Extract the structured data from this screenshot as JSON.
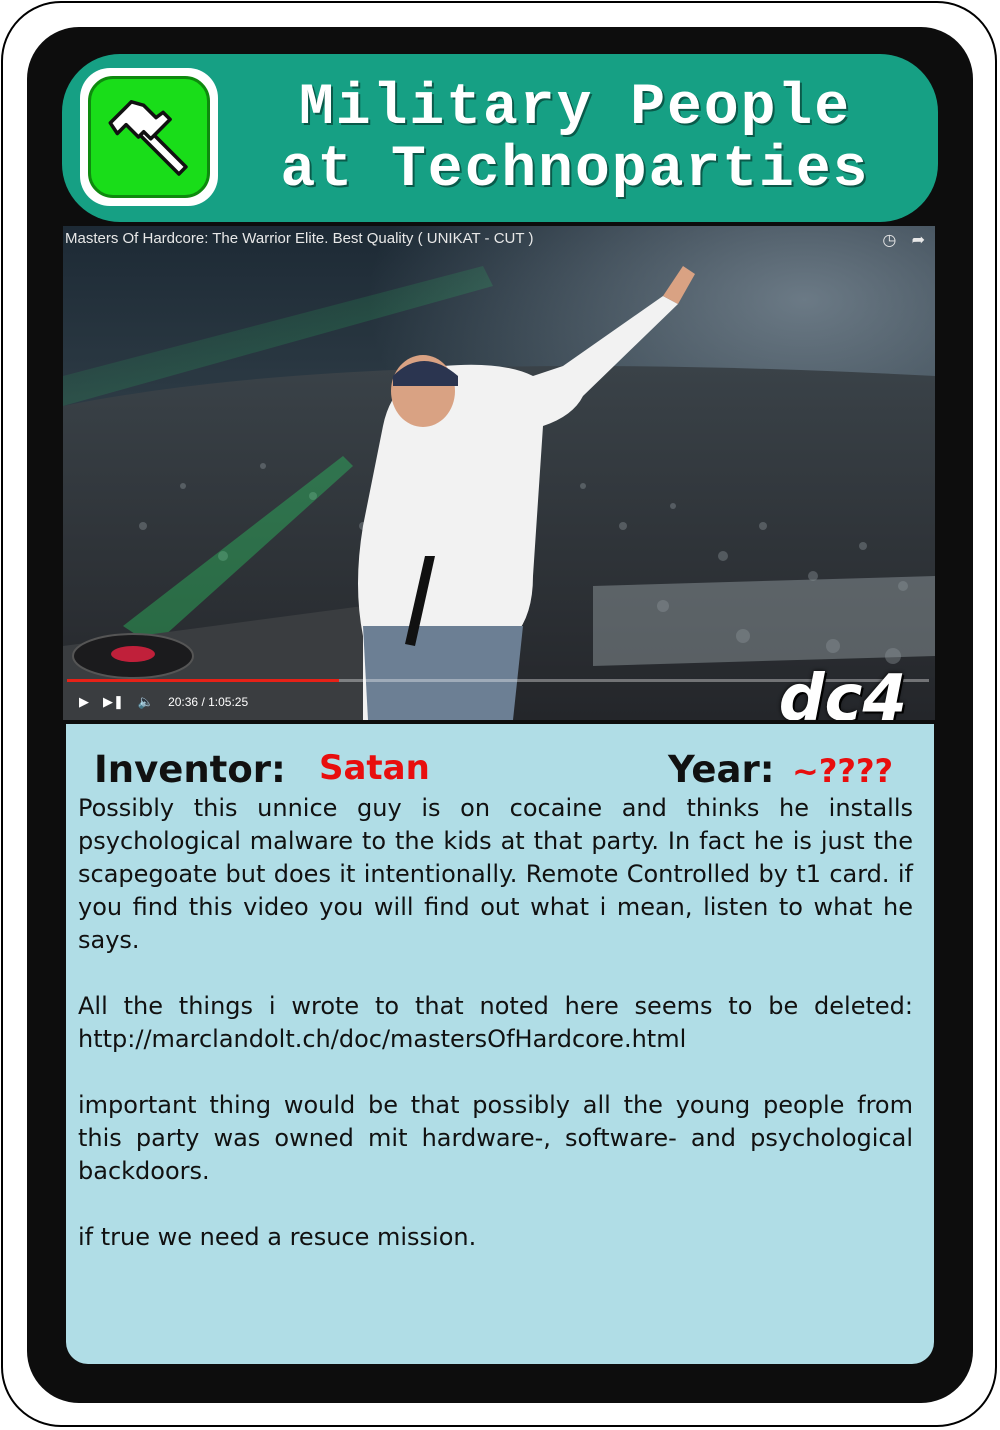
{
  "card": {
    "title_line1": "Military People",
    "title_line2": "at Technoparties",
    "logo_icon": "hammer-icon",
    "colors": {
      "header": "#16a084",
      "logo": "#19dd19",
      "info_bg": "#b0dde6",
      "accent_red": "#e80e0e",
      "frame": "#0d0d0d"
    },
    "badge": "dc4"
  },
  "video": {
    "title": "Masters Of Hardcore: The Warrior Elite. Best Quality ( UNIKAT - CUT )",
    "current_time": "20:36",
    "duration": "1:05:25",
    "time_display": "20:36 / 1:05:25",
    "progress_fraction": 0.315,
    "icons": [
      "clock-icon",
      "share-icon",
      "play-icon",
      "next-icon",
      "volume-icon"
    ]
  },
  "info": {
    "inventor_label": "Inventor:",
    "inventor_value": "Satan",
    "year_label": "Year:",
    "year_value": "~????",
    "paragraphs": [
      "Possibly this unnice guy is on cocaine and thinks he installs psychological malware to the kids at that party. In fact he is just the scapegoate but does it intentionally. Remote Controlled by t1 card. if you find this video you will find out what i mean, listen to what he says.",
      "All the things i wrote to that noted here seems to be deleted: http://marclandolt.ch/doc/mastersOfHardcore.html",
      "important thing would be that possibly all the young people from this party was owned mit hardware-, software- and psychological backdoors.",
      "if true we need a resuce mission."
    ]
  }
}
